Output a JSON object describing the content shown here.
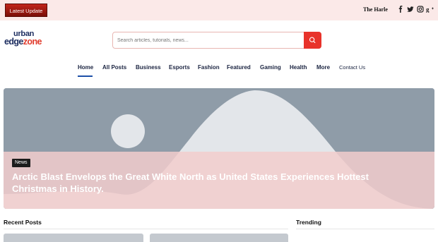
{
  "topbar": {
    "latest_label": "Latest Update",
    "ticker_text": "The Harle",
    "social_icons": [
      "facebook-icon",
      "twitter-icon",
      "instagram-icon",
      "google-plus-icon"
    ]
  },
  "header": {
    "logo_top": "urban",
    "logo_bottom_a": "edge",
    "logo_bottom_b": "zone",
    "search_placeholder": "Search articles, tutorials, news..."
  },
  "nav": {
    "items": [
      {
        "label": "Home"
      },
      {
        "label": "All Posts"
      },
      {
        "label": "Business"
      },
      {
        "label": "Esports"
      },
      {
        "label": "Fashion"
      },
      {
        "label": "Featured"
      },
      {
        "label": "Gaming"
      },
      {
        "label": "Health"
      },
      {
        "label": "More"
      },
      {
        "label": "Contact Us"
      }
    ]
  },
  "hero": {
    "badge": "News",
    "title": "Arctic Blast Envelops the Great White North as United States Experiences Hottest Christmas in History."
  },
  "sections": {
    "recent_posts": "Recent Posts",
    "trending": "Trending"
  },
  "colors": {
    "accent": "#e8322a",
    "topbar_bg": "#fbe9e8",
    "nav_active": "#1d4fa8"
  }
}
